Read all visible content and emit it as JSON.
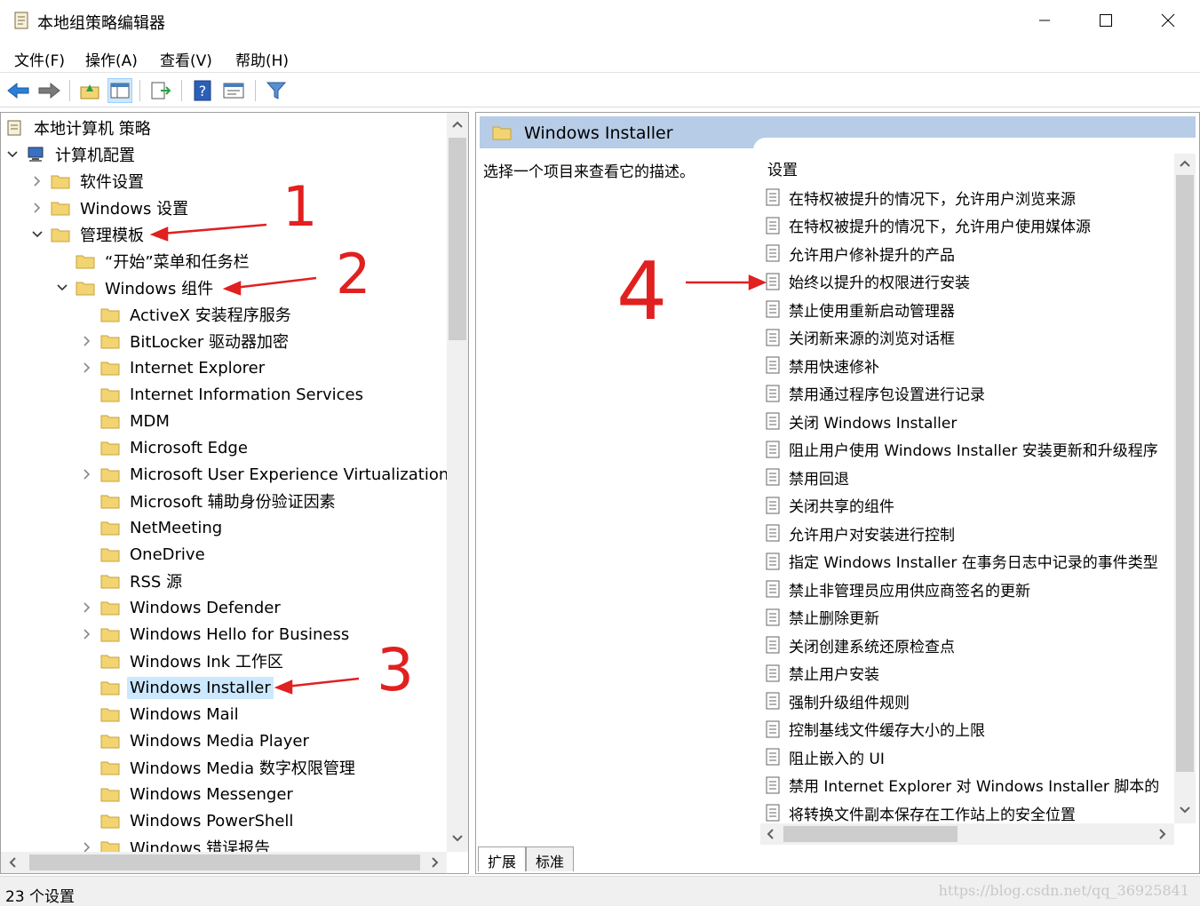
{
  "window": {
    "title": "本地组策略编辑器",
    "controls": {
      "minimize": "minimize-icon",
      "maximize": "maximize-icon",
      "close": "close-icon"
    }
  },
  "menu": [
    "文件(F)",
    "操作(A)",
    "查看(V)",
    "帮助(H)"
  ],
  "toolbar": [
    "back-icon",
    "forward-icon",
    "up-folder-icon",
    "show-tree-icon",
    "export-list-icon",
    "help-icon",
    "properties-icon",
    "filter-icon"
  ],
  "tree": [
    {
      "label": "本地计算机 策略",
      "level": 0,
      "expander": "none",
      "icon": "policy-icon"
    },
    {
      "label": "计算机配置",
      "level": 0,
      "expander": "expanded",
      "icon": "computer-icon"
    },
    {
      "label": "软件设置",
      "level": 1,
      "expander": "collapsed",
      "icon": "folder-icon"
    },
    {
      "label": "Windows 设置",
      "level": 1,
      "expander": "collapsed",
      "icon": "folder-icon"
    },
    {
      "label": "管理模板",
      "level": 1,
      "expander": "expanded",
      "icon": "folder-icon"
    },
    {
      "label": "“开始”菜单和任务栏",
      "level": 2,
      "expander": "none",
      "icon": "folder-icon"
    },
    {
      "label": "Windows 组件",
      "level": 2,
      "expander": "expanded",
      "icon": "folder-icon"
    },
    {
      "label": "ActiveX 安装程序服务",
      "level": 3,
      "expander": "none",
      "icon": "folder-icon"
    },
    {
      "label": "BitLocker 驱动器加密",
      "level": 3,
      "expander": "collapsed",
      "icon": "folder-icon"
    },
    {
      "label": "Internet Explorer",
      "level": 3,
      "expander": "collapsed",
      "icon": "folder-icon"
    },
    {
      "label": "Internet Information Services",
      "level": 3,
      "expander": "none",
      "icon": "folder-icon"
    },
    {
      "label": "MDM",
      "level": 3,
      "expander": "none",
      "icon": "folder-icon"
    },
    {
      "label": "Microsoft Edge",
      "level": 3,
      "expander": "none",
      "icon": "folder-icon"
    },
    {
      "label": "Microsoft User Experience Virtualization",
      "level": 3,
      "expander": "collapsed",
      "icon": "folder-icon"
    },
    {
      "label": "Microsoft 辅助身份验证因素",
      "level": 3,
      "expander": "none",
      "icon": "folder-icon"
    },
    {
      "label": "NetMeeting",
      "level": 3,
      "expander": "none",
      "icon": "folder-icon"
    },
    {
      "label": "OneDrive",
      "level": 3,
      "expander": "none",
      "icon": "folder-icon"
    },
    {
      "label": "RSS 源",
      "level": 3,
      "expander": "none",
      "icon": "folder-icon"
    },
    {
      "label": "Windows Defender",
      "level": 3,
      "expander": "collapsed",
      "icon": "folder-icon"
    },
    {
      "label": "Windows Hello for Business",
      "level": 3,
      "expander": "collapsed",
      "icon": "folder-icon"
    },
    {
      "label": "Windows Ink 工作区",
      "level": 3,
      "expander": "none",
      "icon": "folder-icon"
    },
    {
      "label": "Windows Installer",
      "level": 3,
      "expander": "none",
      "icon": "folder-icon",
      "selected": true
    },
    {
      "label": "Windows Mail",
      "level": 3,
      "expander": "none",
      "icon": "folder-icon"
    },
    {
      "label": "Windows Media Player",
      "level": 3,
      "expander": "none",
      "icon": "folder-icon"
    },
    {
      "label": "Windows Media 数字权限管理",
      "level": 3,
      "expander": "none",
      "icon": "folder-icon"
    },
    {
      "label": "Windows Messenger",
      "level": 3,
      "expander": "none",
      "icon": "folder-icon"
    },
    {
      "label": "Windows PowerShell",
      "level": 3,
      "expander": "none",
      "icon": "folder-icon"
    },
    {
      "label": "Windows 错误报告",
      "level": 3,
      "expander": "collapsed",
      "icon": "folder-icon"
    }
  ],
  "right": {
    "header_title": "Windows Installer",
    "description": "选择一个项目来查看它的描述。",
    "column_header": "设置",
    "settings": [
      "在特权被提升的情况下，允许用户浏览来源",
      "在特权被提升的情况下，允许用户使用媒体源",
      "允许用户修补提升的产品",
      "始终以提升的权限进行安装",
      "禁止使用重新启动管理器",
      "关闭新来源的浏览对话框",
      "禁用快速修补",
      "禁用通过程序包设置进行记录",
      "关闭 Windows Installer",
      "阻止用户使用 Windows Installer 安装更新和升级程序",
      "禁用回退",
      "关闭共享的组件",
      "允许用户对安装进行控制",
      "指定 Windows Installer 在事务日志中记录的事件类型",
      "禁止非管理员应用供应商签名的更新",
      "禁止删除更新",
      "关闭创建系统还原检查点",
      "禁止用户安装",
      "强制升级组件规则",
      "控制基线文件缓存大小的上限",
      "阻止嵌入的 UI",
      "禁用 Internet Explorer 对 Windows Installer 脚本的",
      "将转换文件副本保存在工作站上的安全位置"
    ],
    "tabs": [
      "扩展",
      "标准"
    ]
  },
  "annotations": [
    "1",
    "2",
    "3",
    "4"
  ],
  "status": {
    "text": "23 个设置",
    "watermark": "https://blog.csdn.net/qq_36925841"
  },
  "colors": {
    "selection": "#cce8ff",
    "header_band": "#b7cce6",
    "annotation_red": "#e12020",
    "folder": "#f2d472"
  }
}
